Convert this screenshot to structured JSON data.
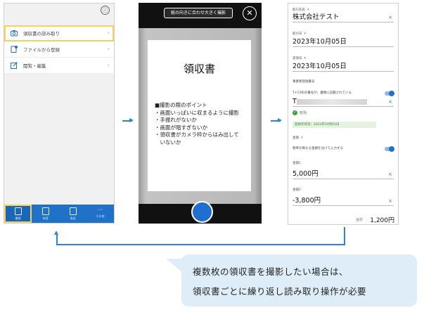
{
  "screen1": {
    "info_glyph": "ⓘ",
    "menu": [
      {
        "label": "領収書の読み取り",
        "icon": "camera-icon",
        "selected": true
      },
      {
        "label": "ファイルから登録",
        "icon": "file-add-icon",
        "selected": false
      },
      {
        "label": "閲覧・編集",
        "icon": "edit-icon",
        "selected": false
      }
    ],
    "tabs": [
      {
        "label": "書類",
        "icon": "receipt-icon",
        "active": true
      },
      {
        "label": "申請",
        "icon": "document-icon",
        "active": false
      },
      {
        "label": "承認",
        "icon": "approve-icon",
        "active": false
      },
      {
        "label": "その他",
        "icon": "more-icon",
        "active": false
      }
    ],
    "more_glyph": "···"
  },
  "screen2": {
    "hint": "紙の向きに合わせ大きく撮影",
    "close_glyph": "✕",
    "receipt_title": "領収書",
    "tips_heading": "■撮影の際のポイント",
    "tips": [
      "・画面いっぱいに収まるように撮影",
      "・手振れがないか",
      "・画面が暗すぎないか",
      "・領収書がカメラ枠からはみ出して",
      "　いないか"
    ]
  },
  "screen3": {
    "payee_label": "取引先名",
    "payee_value": "株式会社テスト",
    "date_label": "取引日",
    "date_value": "2023年10月05日",
    "received_label": "受領日",
    "received_value": "2023年10月05日",
    "reg_section": "事業者登録番号",
    "reg_toggle_label": "T+13桁の番号が、書類に記載されている",
    "reg_prefix": "T",
    "valid_label": "有効",
    "reg_date": "登録年月日：2023年10月01日",
    "amount_section": "金額",
    "split_label": "税率の異なる金額を分けて入力する",
    "amount1_label": "金額1",
    "amount1_value": "5,000円",
    "amount2_label": "金額2",
    "amount2_value": "-3,800円",
    "total_label": "合計",
    "total_value": "1,200円",
    "required_mark": "＊",
    "clear_glyph": "×"
  },
  "callout": {
    "line1": "複数枚の領収書を撮影したい場合は、",
    "line2": "領収書ごとに繰り返し読み取り操作が必要"
  },
  "colors": {
    "accent": "#1f72c7",
    "highlight": "#f3d35a",
    "arrow": "#2a86cf",
    "callout_bg": "#deedf8",
    "valid_green": "#3aa13a"
  }
}
